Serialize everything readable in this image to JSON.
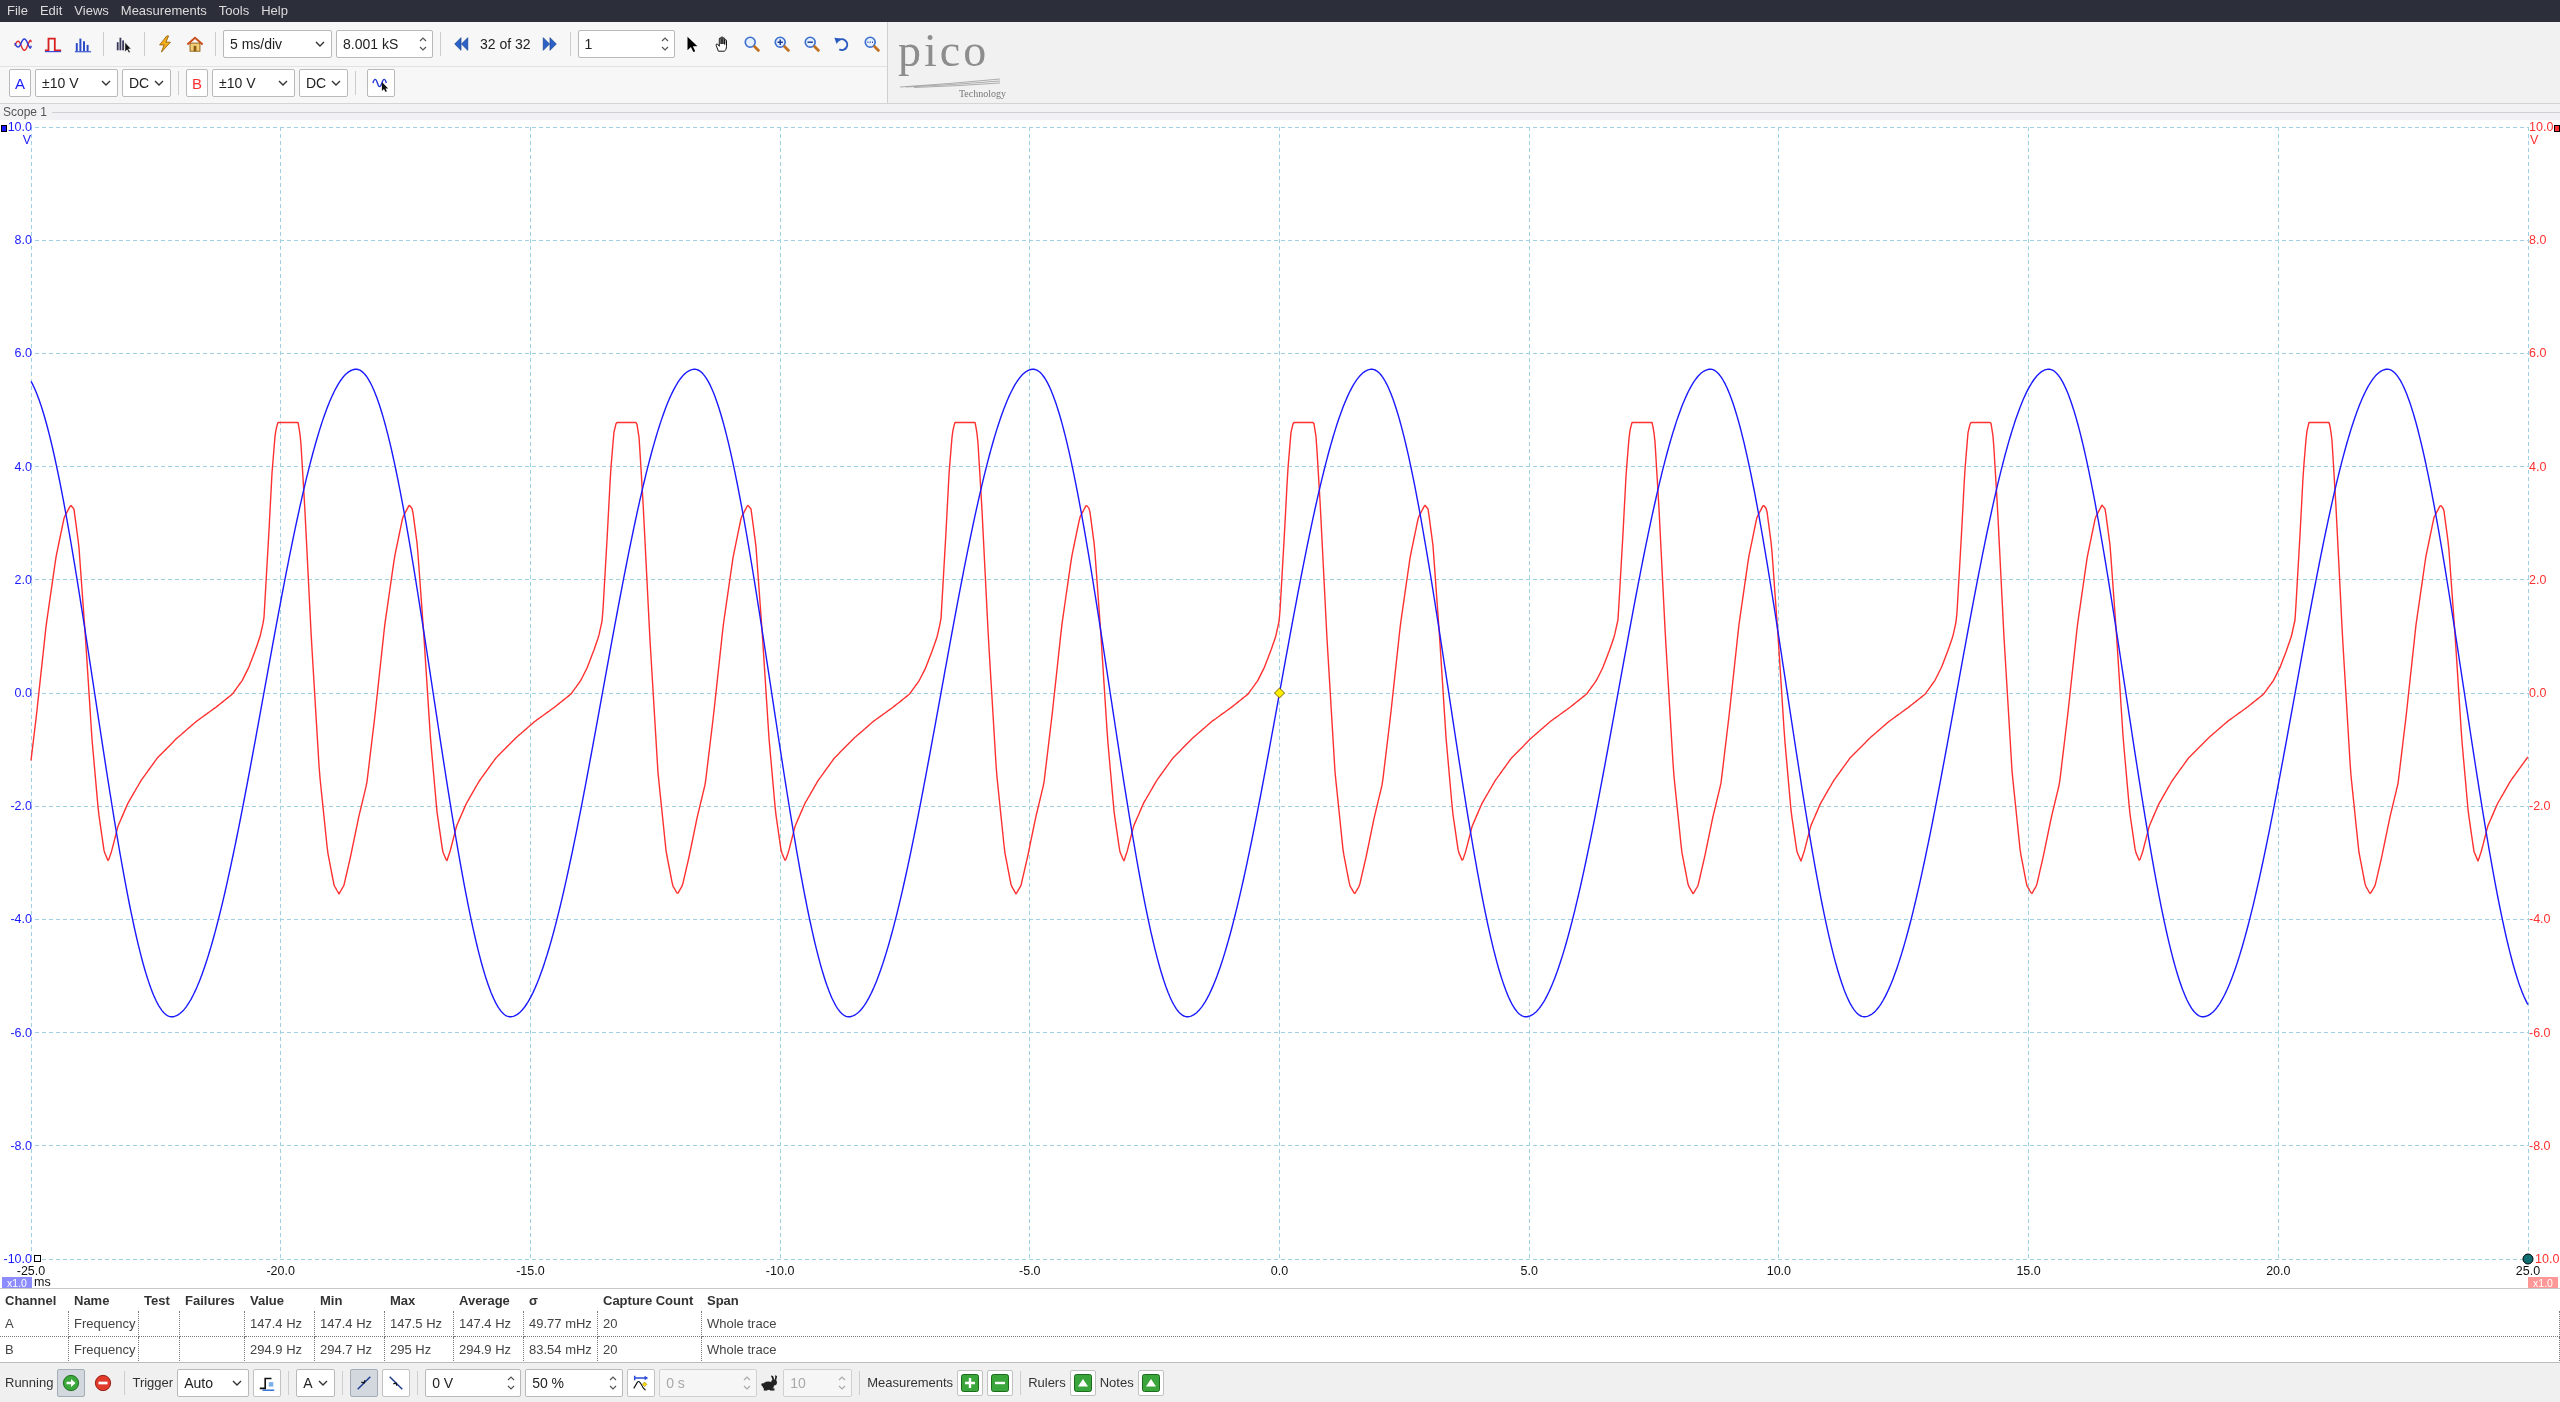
{
  "menu": [
    "File",
    "Edit",
    "Views",
    "Measurements",
    "Tools",
    "Help"
  ],
  "toolbar": {
    "timebase": "5 ms/div",
    "samples": "8.001 kS",
    "capture": "32 of 32",
    "capture_index": "1"
  },
  "channels": [
    {
      "label": "A",
      "color": "#1a1aff",
      "range": "±10 V",
      "coupling": "DC"
    },
    {
      "label": "B",
      "color": "#ff3030",
      "range": "±10 V",
      "coupling": "DC"
    }
  ],
  "logo": {
    "wordmark": "pico",
    "tagline": "Technology"
  },
  "scope": {
    "title": "Scope 1",
    "left_axis": {
      "labels": [
        "10.0",
        "8.0",
        "6.0",
        "4.0",
        "2.0",
        "0.0",
        "-2.0",
        "-4.0",
        "-6.0",
        "-8.0",
        "-10.0"
      ],
      "unit": "V",
      "zoom": "x1.0"
    },
    "right_axis": {
      "labels": [
        "10.0",
        "8.0",
        "6.0",
        "4.0",
        "2.0",
        "0.0",
        "-2.0",
        "-4.0",
        "-6.0",
        "-8.0",
        "10.0"
      ],
      "unit": "V",
      "zoom": "x1.0"
    },
    "x_axis": {
      "labels": [
        "-25.0",
        "-20.0",
        "-15.0",
        "-10.0",
        "-5.0",
        "0.0",
        "5.0",
        "10.0",
        "15.0",
        "20.0",
        "25.0"
      ],
      "unit": "ms"
    }
  },
  "measurements": {
    "columns": [
      "Channel",
      "Name",
      "Test",
      "Failures",
      "Value",
      "Min",
      "Max",
      "Average",
      "σ",
      "Capture Count",
      "Span"
    ],
    "rows": [
      {
        "channel": "A",
        "name": "Frequency",
        "value": "147.4 Hz",
        "min": "147.4 Hz",
        "max": "147.5 Hz",
        "average": "147.4 Hz",
        "sigma": "49.77 mHz",
        "capture_count": "20",
        "span": "Whole trace"
      },
      {
        "channel": "B",
        "name": "Frequency",
        "value": "294.9 Hz",
        "min": "294.7 Hz",
        "max": "295 Hz",
        "average": "294.9 Hz",
        "sigma": "83.54 mHz",
        "capture_count": "20",
        "span": "Whole trace"
      }
    ]
  },
  "status_bar": {
    "run_label": "Running",
    "running": true,
    "trigger_label": "Trigger",
    "trigger_mode": "Auto",
    "trigger_channel": "A",
    "edges": [
      {
        "kind": "rising",
        "selected": true
      },
      {
        "kind": "falling",
        "selected": false
      }
    ],
    "fields": [
      {
        "value": "0 V",
        "disabled": false
      },
      {
        "value": "50 %",
        "disabled": false
      },
      {
        "value": "0 s",
        "disabled": true
      },
      {
        "value": "10",
        "disabled": true
      }
    ],
    "measurements_label": "Measurements",
    "rulers_label": "Rulers",
    "notes_label": "Notes"
  }
}
